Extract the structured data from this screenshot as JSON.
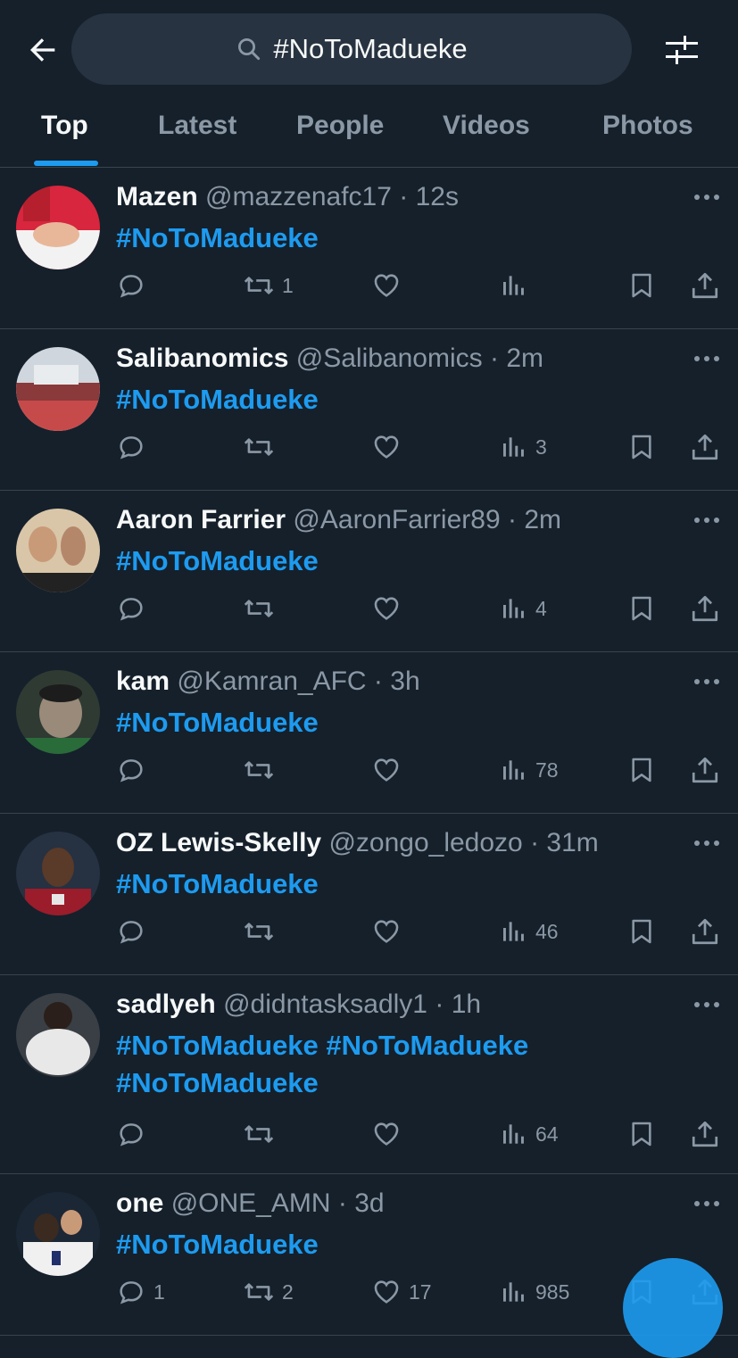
{
  "search": {
    "query": "#NoToMadueke"
  },
  "tabs": [
    {
      "label": "Top",
      "active": true
    },
    {
      "label": "Latest"
    },
    {
      "label": "People"
    },
    {
      "label": "Videos"
    },
    {
      "label": "Photos"
    }
  ],
  "tweets": [
    {
      "name": "Mazen",
      "handle": "@mazzenafc17",
      "sep": "·",
      "time": "12s",
      "hashtags": [
        "#NoToMadueke"
      ],
      "replies": "",
      "retweets": "1",
      "likes": "",
      "views": ""
    },
    {
      "name": "Salibanomics",
      "handle": "@Salibanomics",
      "sep": "·",
      "time": "2m",
      "hashtags": [
        "#NoToMadueke"
      ],
      "replies": "",
      "retweets": "",
      "likes": "",
      "views": "3"
    },
    {
      "name": "Aaron Farrier",
      "handle": "@AaronFarrier89",
      "sep": "·",
      "time": "2m",
      "hashtags": [
        "#NoToMadueke"
      ],
      "replies": "",
      "retweets": "",
      "likes": "",
      "views": "4"
    },
    {
      "name": "kam",
      "handle": "@Kamran_AFC",
      "sep": "·",
      "time": "3h",
      "hashtags": [
        "#NoToMadueke"
      ],
      "replies": "",
      "retweets": "",
      "likes": "",
      "views": "78"
    },
    {
      "name": "OZ Lewis-Skelly",
      "handle": "@zongo_ledozo",
      "sep": "·",
      "time": "31m",
      "hashtags": [
        "#NoToMadueke"
      ],
      "replies": "",
      "retweets": "",
      "likes": "",
      "views": "46"
    },
    {
      "name": "sadlyeh",
      "handle": "@didntasksadly1",
      "sep": "·",
      "time": "1h",
      "hashtags": [
        "#NoToMadueke",
        "#NoToMadueke",
        "#NoToMadueke"
      ],
      "replies": "",
      "retweets": "",
      "likes": "",
      "views": "64"
    },
    {
      "name": "one",
      "handle": "@ONE_AMN",
      "sep": "·",
      "time": "3d",
      "hashtags": [
        "#NoToMadueke"
      ],
      "replies": "1",
      "retweets": "2",
      "likes": "17",
      "views": "985"
    }
  ],
  "icons": {
    "back": "arrow-left-icon",
    "search": "search-icon",
    "filter": "sliders-icon",
    "more": "ellipsis-icon",
    "reply": "reply-icon",
    "retweet": "retweet-icon",
    "like": "heart-icon",
    "views": "views-icon",
    "bookmark": "bookmark-icon",
    "share": "share-icon"
  },
  "colors": {
    "background": "#15202b",
    "accent": "#1d9bf0",
    "muted": "#8b98a5",
    "text": "#f7f9f9",
    "divider": "#38444d"
  }
}
